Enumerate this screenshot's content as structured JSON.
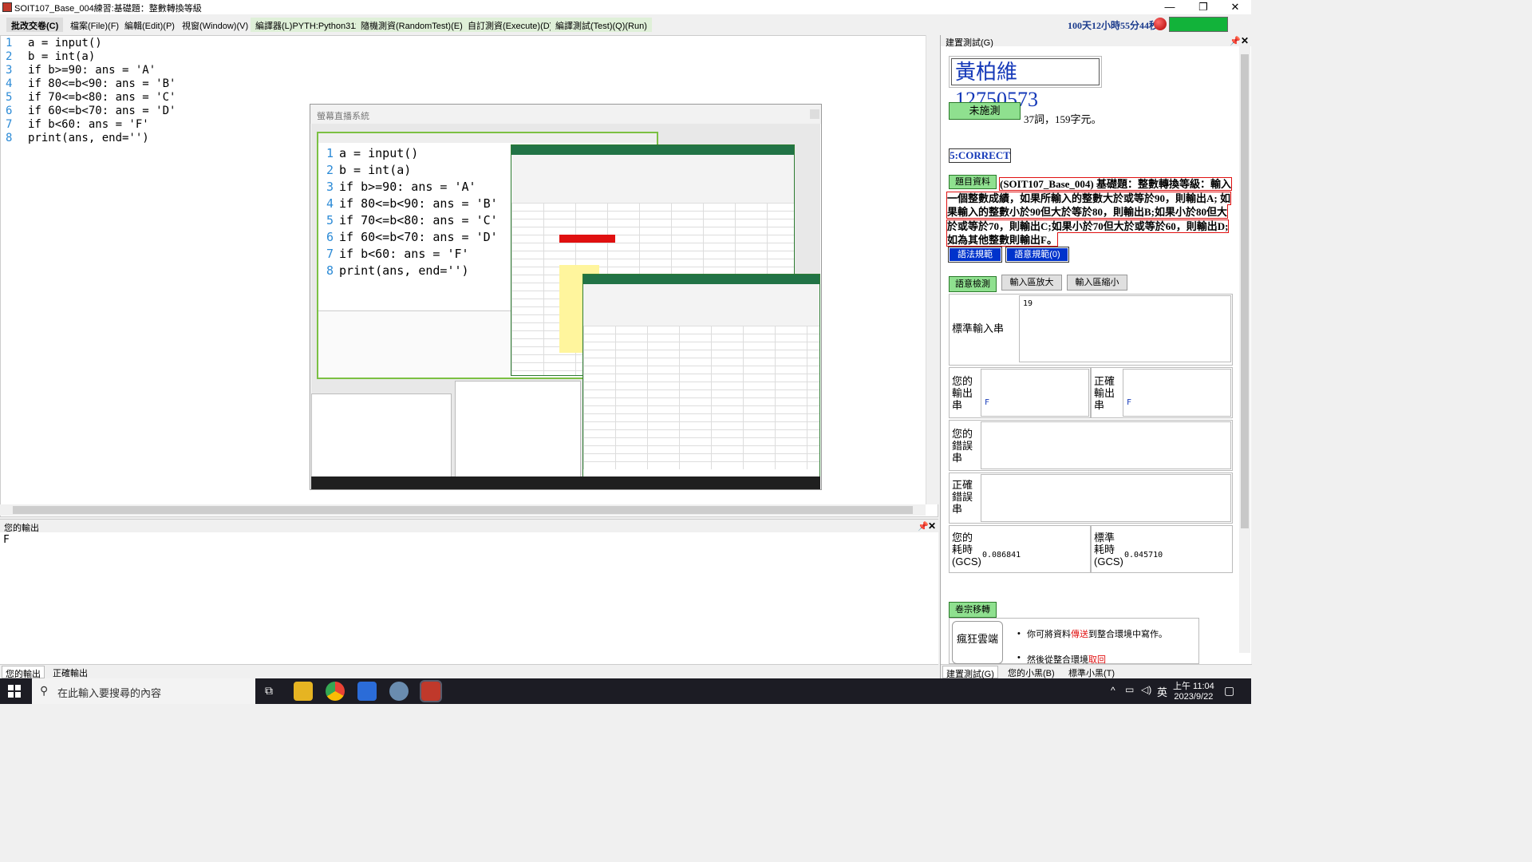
{
  "window": {
    "title": "SOIT107_Base_004練習:基礎題：整數轉換等級",
    "controls": [
      "—",
      "❐",
      "✕"
    ]
  },
  "menu": {
    "items": [
      {
        "label": "批改交卷(C)",
        "style": "active"
      },
      {
        "label": "檔案(File)(F)",
        "style": "normal"
      },
      {
        "label": "編輯(Edit)(P)",
        "style": "normal"
      },
      {
        "label": "視窗(Window)(V)",
        "style": "normal"
      },
      {
        "label": "編譯器(L)PYTH:Python311",
        "style": "green"
      },
      {
        "label": "隨機測資(RandomTest)(E)",
        "style": "green"
      },
      {
        "label": "自訂測資(Execute)(D)",
        "style": "green"
      },
      {
        "label": "編譯測試(Test)(Q)(Run)",
        "style": "green"
      }
    ],
    "timer": "100天12小時55分44秒"
  },
  "editor": {
    "line_numbers": [
      "1",
      "2",
      "3",
      "4",
      "5",
      "6",
      "7",
      "8"
    ],
    "code_lines": [
      "a = input()",
      "b = int(a)",
      "if b>=90: ans = 'A'",
      "if 80<=b<90: ans = 'B'",
      "if 70<=b<80: ans = 'C'",
      "if 60<=b<70: ans = 'D'",
      "if b<60: ans = 'F'",
      "print(ans, end='')"
    ]
  },
  "screenshare": {
    "title": "螢幕直播系統"
  },
  "output_panel": {
    "title": "您的輸出",
    "content": "F",
    "tabs": [
      "您的輸出",
      "正確輸出"
    ]
  },
  "right_panel": {
    "title": "建置測試(G)",
    "name": "黃柏維12750573",
    "status_button": "未施測",
    "stats": "37詞，159字元。",
    "result": "5:CORRECT",
    "problem_tag": "題目資料",
    "problem_text": "(SOIT107_Base_004) 基礎題：整數轉換等級：輸入一個整數成績，如果所輸入的整數大於或等於90，則輸出A; 如果輸入的整數小於90但大於等於80，則輸出B;如果小於80但大於或等於70，則輸出C;如果小於70但大於或等於60，則輸出D;如為其他整數則輸出F。",
    "syntax_button": "語法規範",
    "semantic_button": "語意規範(0)",
    "tabs": [
      "語意檢測",
      "輸入區放大",
      "輸入區縮小"
    ],
    "std_input_label": "標準輸入串",
    "std_input_value": "19",
    "your_output_label": "您的輸出串",
    "your_output_value": "F",
    "correct_output_label": "正確輸出串",
    "correct_output_value": "F",
    "your_error_label": "您的錯誤串",
    "correct_error_label": "正確錯誤串",
    "your_time_label": "您的耗時(GCS)",
    "your_time_value": "0.086841",
    "std_time_label": "標準耗時(GCS)",
    "std_time_value": "0.045710",
    "transfer_tab": "卷宗移轉",
    "cloud_button": "瘋狂雲端",
    "bullet1_a": "你可將資料",
    "bullet1_b": "傳送",
    "bullet1_c": "到整合環境中寫作。",
    "bullet2_a": "然後從整合環境",
    "bullet2_b": "取回",
    "bottom_tabs": [
      "建置測試(G)",
      "您的小黑(B)",
      "標準小黑(T)"
    ]
  },
  "taskbar": {
    "search_placeholder": "在此輸入要搜尋的內容",
    "ime": "英",
    "time": "上午 11:04",
    "date": "2023/9/22"
  }
}
